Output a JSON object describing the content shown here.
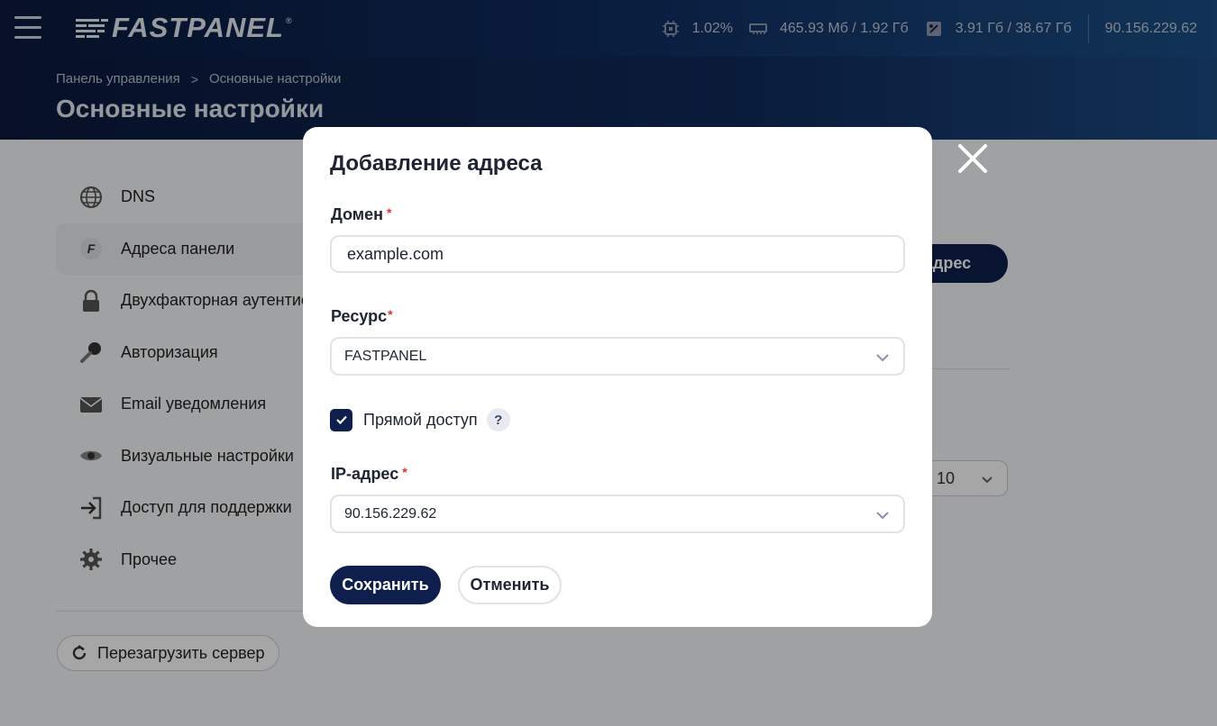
{
  "topbar": {
    "logo_text": "FASTPANEL",
    "logo_reg": "®",
    "cpu": "1.02%",
    "ram": "465.93 Мб / 1.92 Гб",
    "disk": "3.91 Гб / 38.67 Гб",
    "ip": "90.156.229.62"
  },
  "breadcrumb": {
    "root": "Панель управления",
    "separator": ">",
    "current": "Основные настройки"
  },
  "page_title": "Основные настройки",
  "sidebar": {
    "items": [
      {
        "label": "DNS",
        "icon": "globe-icon"
      },
      {
        "label": "Адреса панели",
        "icon": "fastpanel-f-icon",
        "active": true
      },
      {
        "label": "Двухфакторная аутентис",
        "icon": "lock-icon"
      },
      {
        "label": "Авторизация",
        "icon": "key-icon"
      },
      {
        "label": "Email уведомления",
        "icon": "envelope-icon"
      },
      {
        "label": "Визуальные настройки",
        "icon": "eye-icon"
      },
      {
        "label": "Доступ для поддержки",
        "icon": "login-arrow-icon"
      },
      {
        "label": "Прочее",
        "icon": "gear-icon"
      }
    ],
    "reboot_label": "Перезагрузить сервер"
  },
  "background": {
    "add_button_partial": "ть адрес",
    "per_page": "10"
  },
  "modal": {
    "title": "Добавление адреса",
    "domain_label": "Домен",
    "domain_value": "example.com",
    "resource_label": "Ресурс",
    "resource_value": "FASTPANEL",
    "direct_access_label": "Прямой доступ",
    "direct_access_checked": true,
    "help_symbol": "?",
    "ip_label": "IP-адрес",
    "ip_value": "90.156.229.62",
    "required_mark": "*",
    "save_label": "Сохранить",
    "cancel_label": "Отменить"
  },
  "colors": {
    "primary": "#0f1f4d",
    "required": "#e0312c",
    "topbar_start": "#0b1a3d",
    "topbar_end": "#1b4f86"
  }
}
